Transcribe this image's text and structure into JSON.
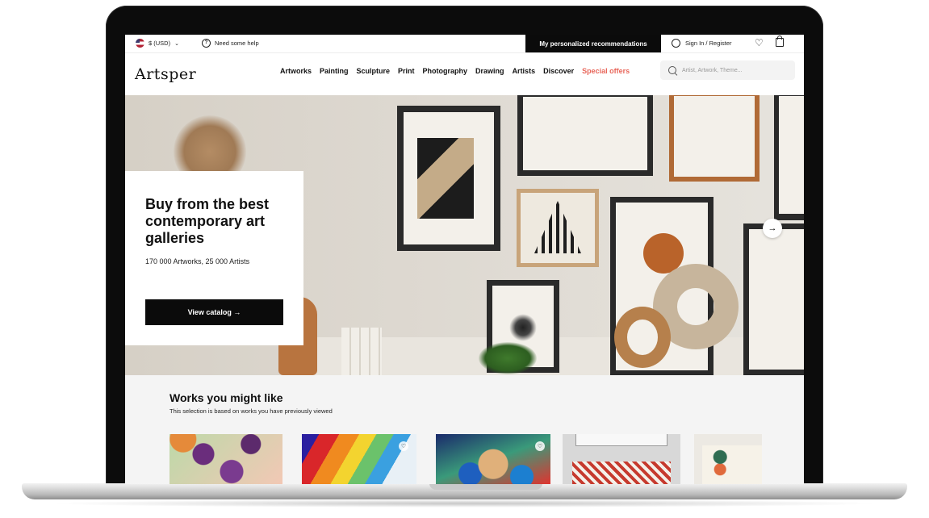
{
  "topbar": {
    "currency": "$ (USD)",
    "help": "Need some help",
    "recommendations": "My personalized recommendations",
    "signin": "Sign In / Register"
  },
  "nav": {
    "logo": "Artsper",
    "items": [
      "Artworks",
      "Painting",
      "Sculpture",
      "Print",
      "Photography",
      "Drawing",
      "Artists",
      "Discover"
    ],
    "special": "Special offers",
    "search_placeholder": "Artist, Artwork, Theme..."
  },
  "hero": {
    "title": "Buy from the best contemporary art galleries",
    "subtitle": "170 000 Artworks, 25 000 Artists",
    "cta": "View catalog →"
  },
  "works": {
    "title": "Works you might like",
    "subtitle": "This selection is based on works you have previously viewed"
  },
  "icons": {
    "currency_dropdown": "chevron-down-icon",
    "help": "help-circle-icon",
    "user": "user-icon",
    "wishlist": "heart-icon",
    "cart": "shopping-bag-icon",
    "search": "search-icon",
    "next": "arrow-right-icon"
  },
  "colors": {
    "accent_special": "#e8665a",
    "dark": "#0b0b0b"
  }
}
